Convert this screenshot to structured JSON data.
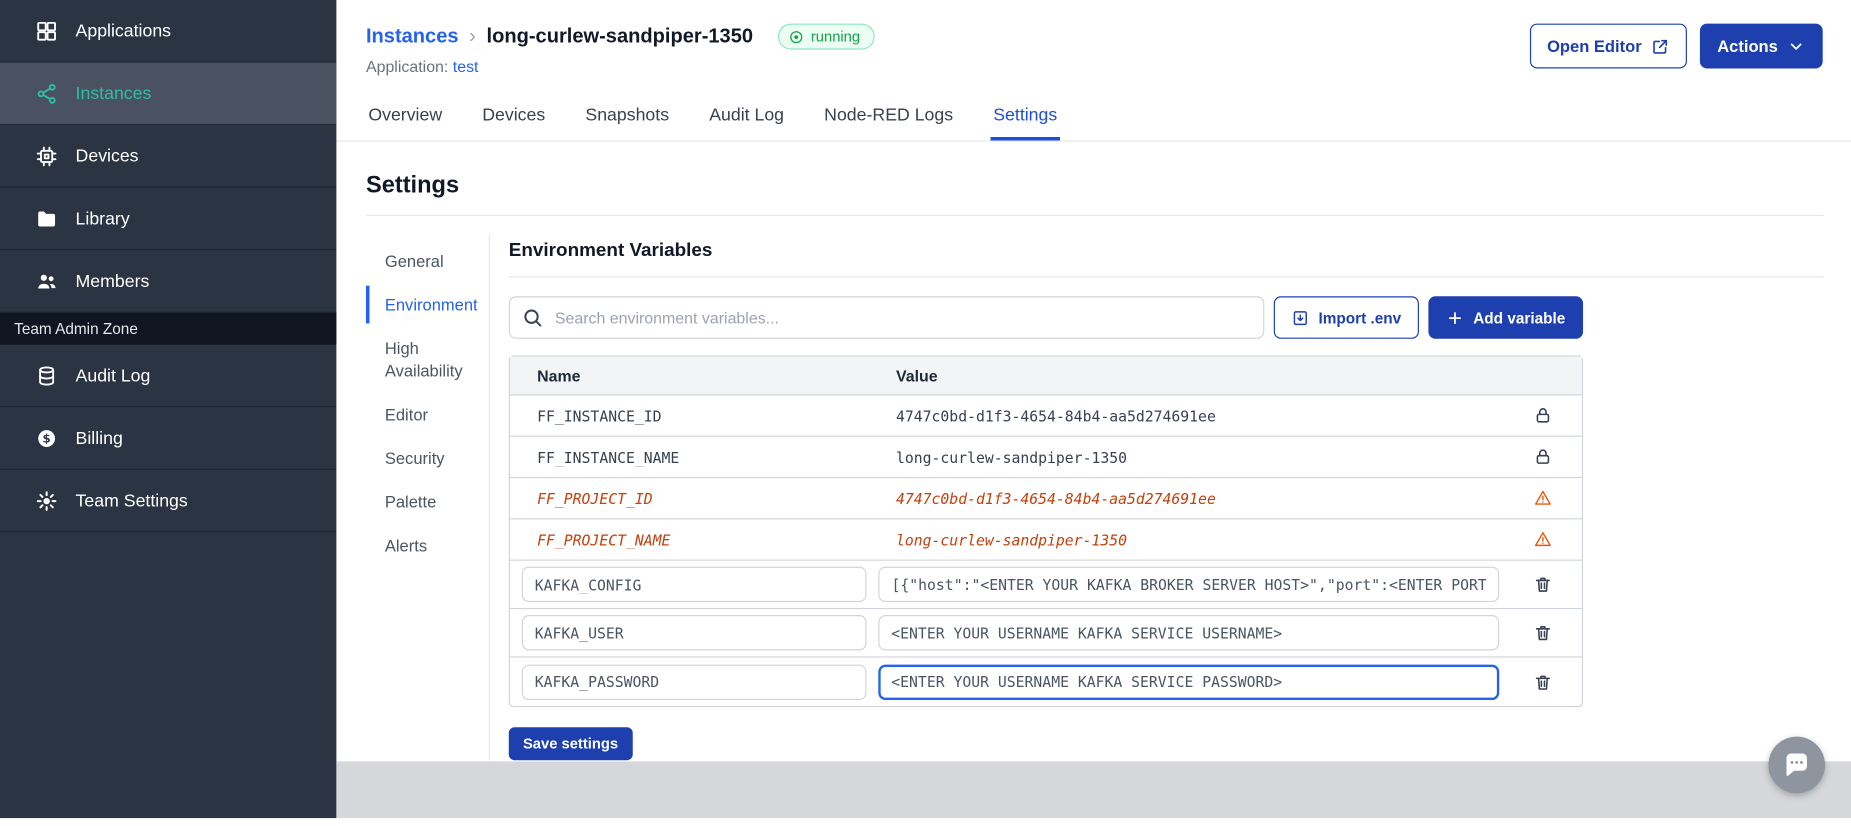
{
  "sidebar": {
    "items": [
      {
        "label": "Applications",
        "icon": "applications-icon"
      },
      {
        "label": "Instances",
        "icon": "instances-icon"
      },
      {
        "label": "Devices",
        "icon": "devices-icon"
      },
      {
        "label": "Library",
        "icon": "library-icon"
      },
      {
        "label": "Members",
        "icon": "members-icon"
      }
    ],
    "active_item": "Instances",
    "section_label": "Team Admin Zone",
    "admin_items": [
      {
        "label": "Audit Log",
        "icon": "audit-log-icon"
      },
      {
        "label": "Billing",
        "icon": "billing-icon"
      },
      {
        "label": "Team Settings",
        "icon": "team-settings-icon"
      }
    ]
  },
  "header": {
    "breadcrumb_parent": "Instances",
    "breadcrumb_separator": "›",
    "instance_name": "long-curlew-sandpiper-1350",
    "status_badge": "running",
    "application_label": "Application:",
    "application_name": "test",
    "open_editor_label": "Open Editor",
    "actions_label": "Actions"
  },
  "tabs": {
    "active": "Settings",
    "items": [
      {
        "label": "Overview"
      },
      {
        "label": "Devices"
      },
      {
        "label": "Snapshots"
      },
      {
        "label": "Audit Log"
      },
      {
        "label": "Node-RED Logs"
      },
      {
        "label": "Settings"
      }
    ]
  },
  "settings": {
    "title": "Settings",
    "nav": [
      {
        "label": "General"
      },
      {
        "label": "Environment"
      },
      {
        "label": "High Availability"
      },
      {
        "label": "Editor"
      },
      {
        "label": "Security"
      },
      {
        "label": "Palette"
      },
      {
        "label": "Alerts"
      }
    ],
    "active_nav": "Environment",
    "env": {
      "title": "Environment Variables",
      "search_placeholder": "Search environment variables...",
      "import_label": "Import .env",
      "add_label": "Add variable",
      "save_label": "Save settings",
      "table": {
        "columns": [
          "Name",
          "Value"
        ],
        "rows": [
          {
            "name": "FF_INSTANCE_ID",
            "value": "4747c0bd-d1f3-4654-84b4-aa5d274691ee",
            "type": "locked"
          },
          {
            "name": "FF_INSTANCE_NAME",
            "value": "long-curlew-sandpiper-1350",
            "type": "locked"
          },
          {
            "name": "FF_PROJECT_ID",
            "value": "4747c0bd-d1f3-4654-84b4-aa5d274691ee",
            "type": "deprecated"
          },
          {
            "name": "FF_PROJECT_NAME",
            "value": "long-curlew-sandpiper-1350",
            "type": "deprecated"
          },
          {
            "name": "KAFKA_CONFIG",
            "value": "[{\"host\":\"<ENTER YOUR KAFKA BROKER SERVER HOST>\",\"port\":<ENTER PORT>}]",
            "type": "editable"
          },
          {
            "name": "KAFKA_USER",
            "value": "<ENTER YOUR USERNAME KAFKA SERVICE USERNAME>",
            "type": "editable"
          },
          {
            "name": "KAFKA_PASSWORD",
            "value": "<ENTER YOUR USERNAME KAFKA SERVICE PASSWORD>",
            "type": "editable",
            "focused": true
          }
        ]
      }
    }
  },
  "colors": {
    "accent_blue": "#1e40af",
    "link_blue": "#2563eb",
    "sidebar_active_teal": "#2dbea6",
    "running_green": "#16a34a",
    "deprecated_orange": "#c2410c",
    "sidebar_bg": "#2b3443"
  }
}
